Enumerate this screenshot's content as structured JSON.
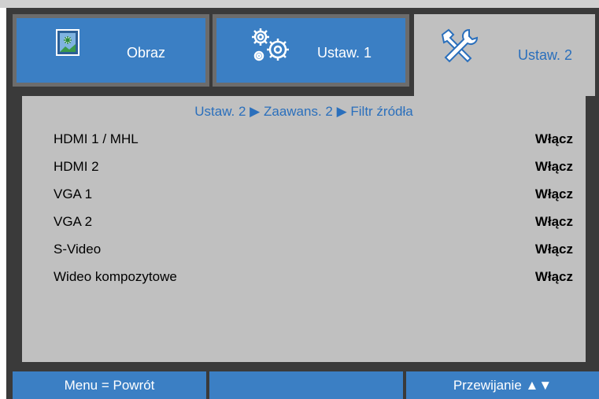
{
  "tabs": [
    {
      "label": "Obraz",
      "icon": "picture-icon",
      "active": false
    },
    {
      "label": "Ustaw. 1",
      "icon": "gears-icon",
      "active": false
    },
    {
      "label": "Ustaw. 2",
      "icon": "tools-icon",
      "active": true
    }
  ],
  "breadcrumb": "Ustaw. 2 ▶ Zaawans. 2 ▶ Filtr źródła",
  "rows": [
    {
      "name": "HDMI 1 / MHL",
      "value": "Włącz"
    },
    {
      "name": "HDMI 2",
      "value": "Włącz"
    },
    {
      "name": "VGA 1",
      "value": "Włącz"
    },
    {
      "name": "VGA 2",
      "value": "Włącz"
    },
    {
      "name": "S-Video",
      "value": "Włącz"
    },
    {
      "name": "Wideo kompozytowe",
      "value": "Włącz"
    }
  ],
  "footer": {
    "left": "Menu = Powrót",
    "middle": "",
    "right": "Przewijanie ▲▼"
  },
  "colors": {
    "accent": "#3b7fc4",
    "panel": "#c0c0c0",
    "frame": "#3a3a3a",
    "text_accent": "#2a6fbc"
  }
}
